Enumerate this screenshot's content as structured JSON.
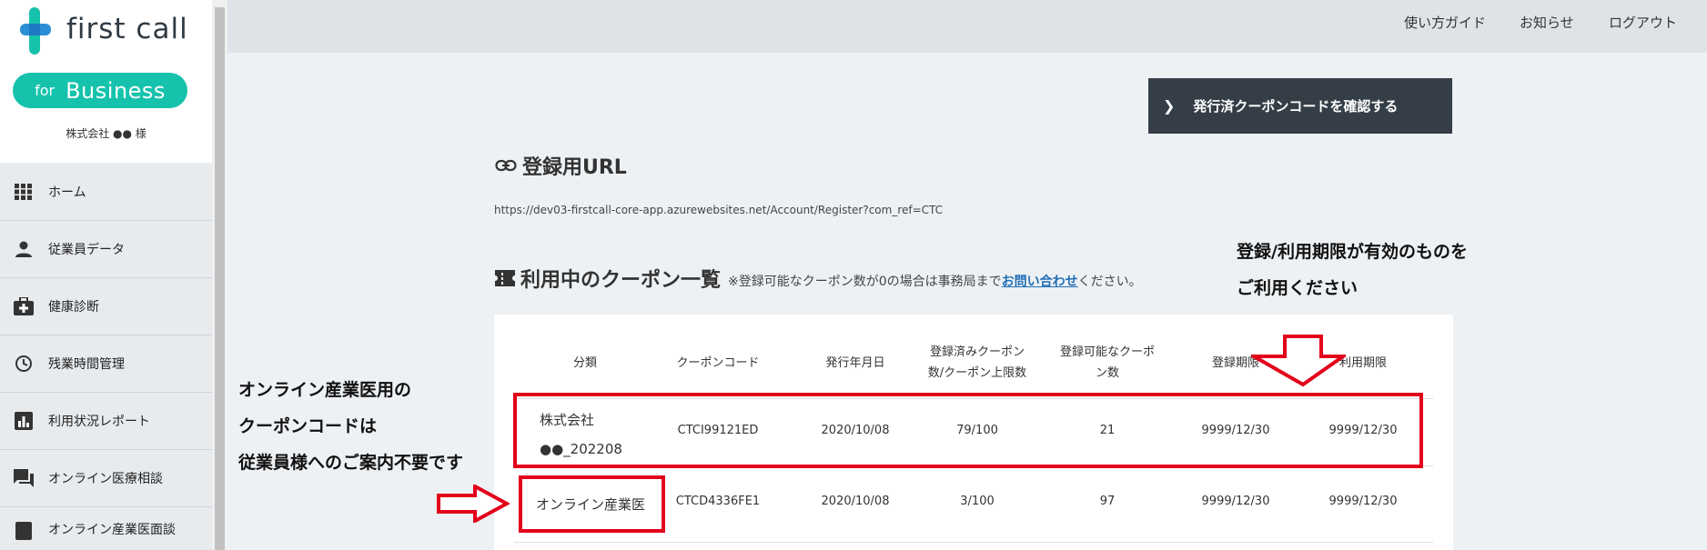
{
  "brand": {
    "logo_text": "first call",
    "badge_for": "for",
    "badge_word": "Business",
    "company_label": "株式会社 ●● 様",
    "colors": {
      "teal": "#16c2ac",
      "blue": "#2b8fd6",
      "dark_btn": "#353e47",
      "red_annotation": "#e3001b"
    }
  },
  "sidebar": {
    "items": [
      {
        "label": "ホーム",
        "icon": "grid-icon"
      },
      {
        "label": "従業員データ",
        "icon": "person-icon"
      },
      {
        "label": "健康診断",
        "icon": "medical-bag-icon"
      },
      {
        "label": "残業時間管理",
        "icon": "clock-icon"
      },
      {
        "label": "利用状況レポート",
        "icon": "bar-chart-icon"
      },
      {
        "label": "オンライン医療相談",
        "icon": "chat-icon"
      },
      {
        "label": "オンライン産業医面談",
        "icon": "document-icon"
      }
    ]
  },
  "topbar": {
    "links": [
      "使い方ガイド",
      "お知らせ",
      "ログアウト"
    ]
  },
  "main": {
    "issued_button_label": "発行済クーポンコードを確認する",
    "url_section": {
      "title": "登録用URL",
      "url": "https://dev03-firstcall-core-app.azurewebsites.net/Account/Register?com_ref=CTC"
    },
    "coupon_section": {
      "title": "利用中のクーポン一覧",
      "note_prefix": "※登録可能なクーポン数が0の場合は事務局まで",
      "note_link": "お問い合わせ",
      "note_suffix": "ください。"
    },
    "table": {
      "headers": [
        "分類",
        "クーポンコード",
        "発行年月日",
        "登録済みクーポン数/クーポン上限数",
        "登録可能なクーポン数",
        "登録期限",
        "利用期限"
      ],
      "rows": [
        {
          "category": "株式会社●●_202208",
          "code": "CTCI99121ED",
          "issued": "2020/10/08",
          "registered": "79/100",
          "available": "21",
          "reg_deadline": "9999/12/30",
          "use_deadline": "9999/12/30"
        },
        {
          "category": "オンライン産業医",
          "code": "CTCD4336FE1",
          "issued": "2020/10/08",
          "registered": "3/100",
          "available": "97",
          "reg_deadline": "9999/12/30",
          "use_deadline": "9999/12/30"
        }
      ]
    }
  },
  "annotations": {
    "right_text": [
      "登録/利用期限が有効のものを",
      "ご利用ください"
    ],
    "left_text": [
      "オンライン産業医用の",
      "クーポンコードは",
      "従業員様へのご案内不要です"
    ]
  }
}
